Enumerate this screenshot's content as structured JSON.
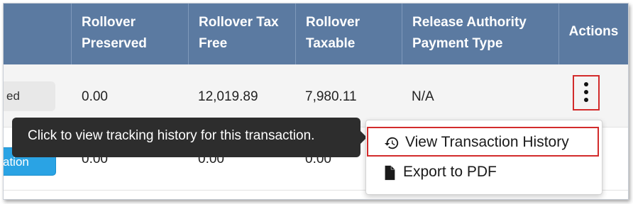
{
  "table": {
    "headers": {
      "rollover_preserved": [
        "Rollover",
        "Preserved"
      ],
      "rollover_tax_free": [
        "Rollover Tax",
        "Free"
      ],
      "rollover_taxable": [
        "Rollover",
        "Taxable"
      ],
      "release_authority": [
        "Release Authority",
        "Payment Type"
      ],
      "actions": "Actions"
    },
    "rows": [
      {
        "status_label": "ed",
        "rollover_preserved": "0.00",
        "rollover_tax_free": "12,019.89",
        "rollover_taxable": "7,980.11",
        "release_authority": "N/A"
      },
      {
        "status_label": "ation",
        "rollover_preserved": "0.00",
        "rollover_tax_free": "0.00",
        "rollover_taxable": "0.00"
      }
    ]
  },
  "tooltip": {
    "text": "Click to view tracking history for this transaction."
  },
  "menu": {
    "items": [
      {
        "label": "View Transaction History",
        "icon": "history-icon"
      },
      {
        "label": "Export to PDF",
        "icon": "file-icon"
      }
    ]
  },
  "colors": {
    "header_bg": "#5b7aa1",
    "highlight": "#d22b2b",
    "tooltip_bg": "#2d2d2d",
    "pill_blue": "#2aa3e4"
  }
}
